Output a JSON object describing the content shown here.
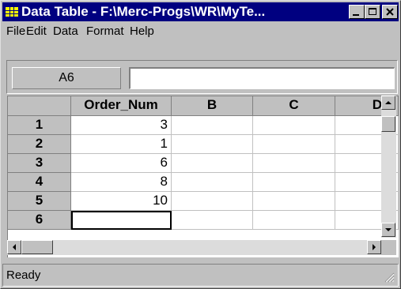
{
  "window": {
    "title": "Data Table - F:\\Merc-Progs\\WR\\MyTe...",
    "colors": {
      "titlebar": "#000080",
      "face": "#c0c0c0"
    }
  },
  "menu": [
    {
      "label": "File"
    },
    {
      "label": "Edit"
    },
    {
      "label": "Data"
    },
    {
      "label": "Format"
    },
    {
      "label": "Help"
    }
  ],
  "formula_bar": {
    "cell_ref": "A6",
    "value": ""
  },
  "grid": {
    "columns": [
      "Order_Num",
      "B",
      "C",
      "D"
    ],
    "rows": [
      {
        "num": "1",
        "A": "3"
      },
      {
        "num": "2",
        "A": "1"
      },
      {
        "num": "3",
        "A": "6"
      },
      {
        "num": "4",
        "A": "8"
      },
      {
        "num": "5",
        "A": "10"
      },
      {
        "num": "6",
        "A": ""
      }
    ],
    "selected_cell": "A6"
  },
  "status": {
    "text": "Ready"
  },
  "icons": [
    "table-icon",
    "minimize-icon",
    "maximize-icon",
    "close-icon",
    "scroll-up-icon",
    "scroll-down-icon",
    "scroll-left-icon",
    "scroll-right-icon",
    "resize-grip-icon"
  ]
}
